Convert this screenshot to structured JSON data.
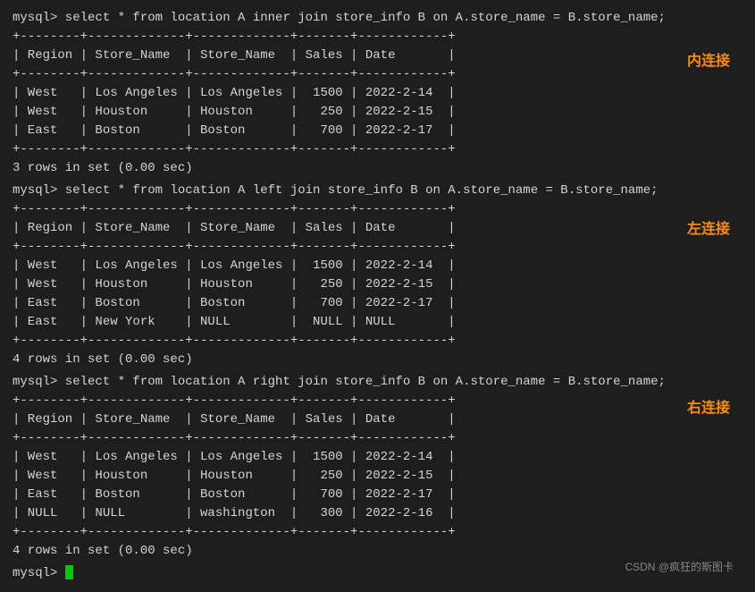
{
  "terminal": {
    "bg": "#1e1e1e",
    "text_color": "#d4d4d4"
  },
  "blocks": [
    {
      "id": "inner-join",
      "command": "mysql> select * from location A inner join store_info B on A.store_name = B.store_name;",
      "label": "内连接",
      "label_top": "48px",
      "label_right": "14px",
      "table": "+--------+-------------+-------------+-------+------------+\n| Region | Store_Name  | Store_Name  | Sales | Date       |\n+--------+-------------+-------------+-------+------------+\n| West   | Los Angeles | Los Angeles |  1500 | 2022-2-14  |\n| West   | Houston     | Houston     |   250 | 2022-2-15  |\n| East   | Boston      | Boston      |   700 | 2022-2-17  |\n+--------+-------------+-------------+-------+------------+",
      "footer": "3 rows in set (0.00 sec)"
    },
    {
      "id": "left-join",
      "command": "mysql> select * from location A left join store_info B on A.store_name = B.store_name;",
      "label": "左连接",
      "label_top": "236px",
      "label_right": "14px",
      "table": "+--------+-------------+-------------+-------+------------+\n| Region | Store_Name  | Store_Name  | Sales | Date       |\n+--------+-------------+-------------+-------+------------+\n| West   | Los Angeles | Los Angeles |  1500 | 2022-2-14  |\n| West   | Houston     | Houston     |   250 | 2022-2-15  |\n| East   | Boston      | Boston      |   700 | 2022-2-17  |\n| East   | New York    | NULL        |  NULL | NULL       |\n+--------+-------------+-------------+-------+------------+",
      "footer": "4 rows in set (0.00 sec)"
    },
    {
      "id": "right-join",
      "command": "mysql> select * from location A right join store_info B on A.store_name = B.store_name;",
      "label": "右连接",
      "label_top": "436px",
      "label_right": "14px",
      "table": "+--------+-------------+-------------+-------+------------+\n| Region | Store_Name  | Store_Name  | Sales | Date       |\n+--------+-------------+-------------+-------+------------+\n| West   | Los Angeles | Los Angeles |  1500 | 2022-2-14  |\n| West   | Houston     | Houston     |   250 | 2022-2-15  |\n| East   | Boston      | Boston      |   700 | 2022-2-17  |\n| NULL   | NULL        | washington  |   300 | 2022-2-16  |\n+--------+-------------+-------------+-------+------------+",
      "footer": "4 rows in set (0.00 sec)"
    }
  ],
  "prompt": "mysql> ",
  "watermark": "CSDN @疯狂的斯图卡",
  "labels": {
    "inner": "内连接",
    "left": "左连接",
    "right": "右连接"
  }
}
